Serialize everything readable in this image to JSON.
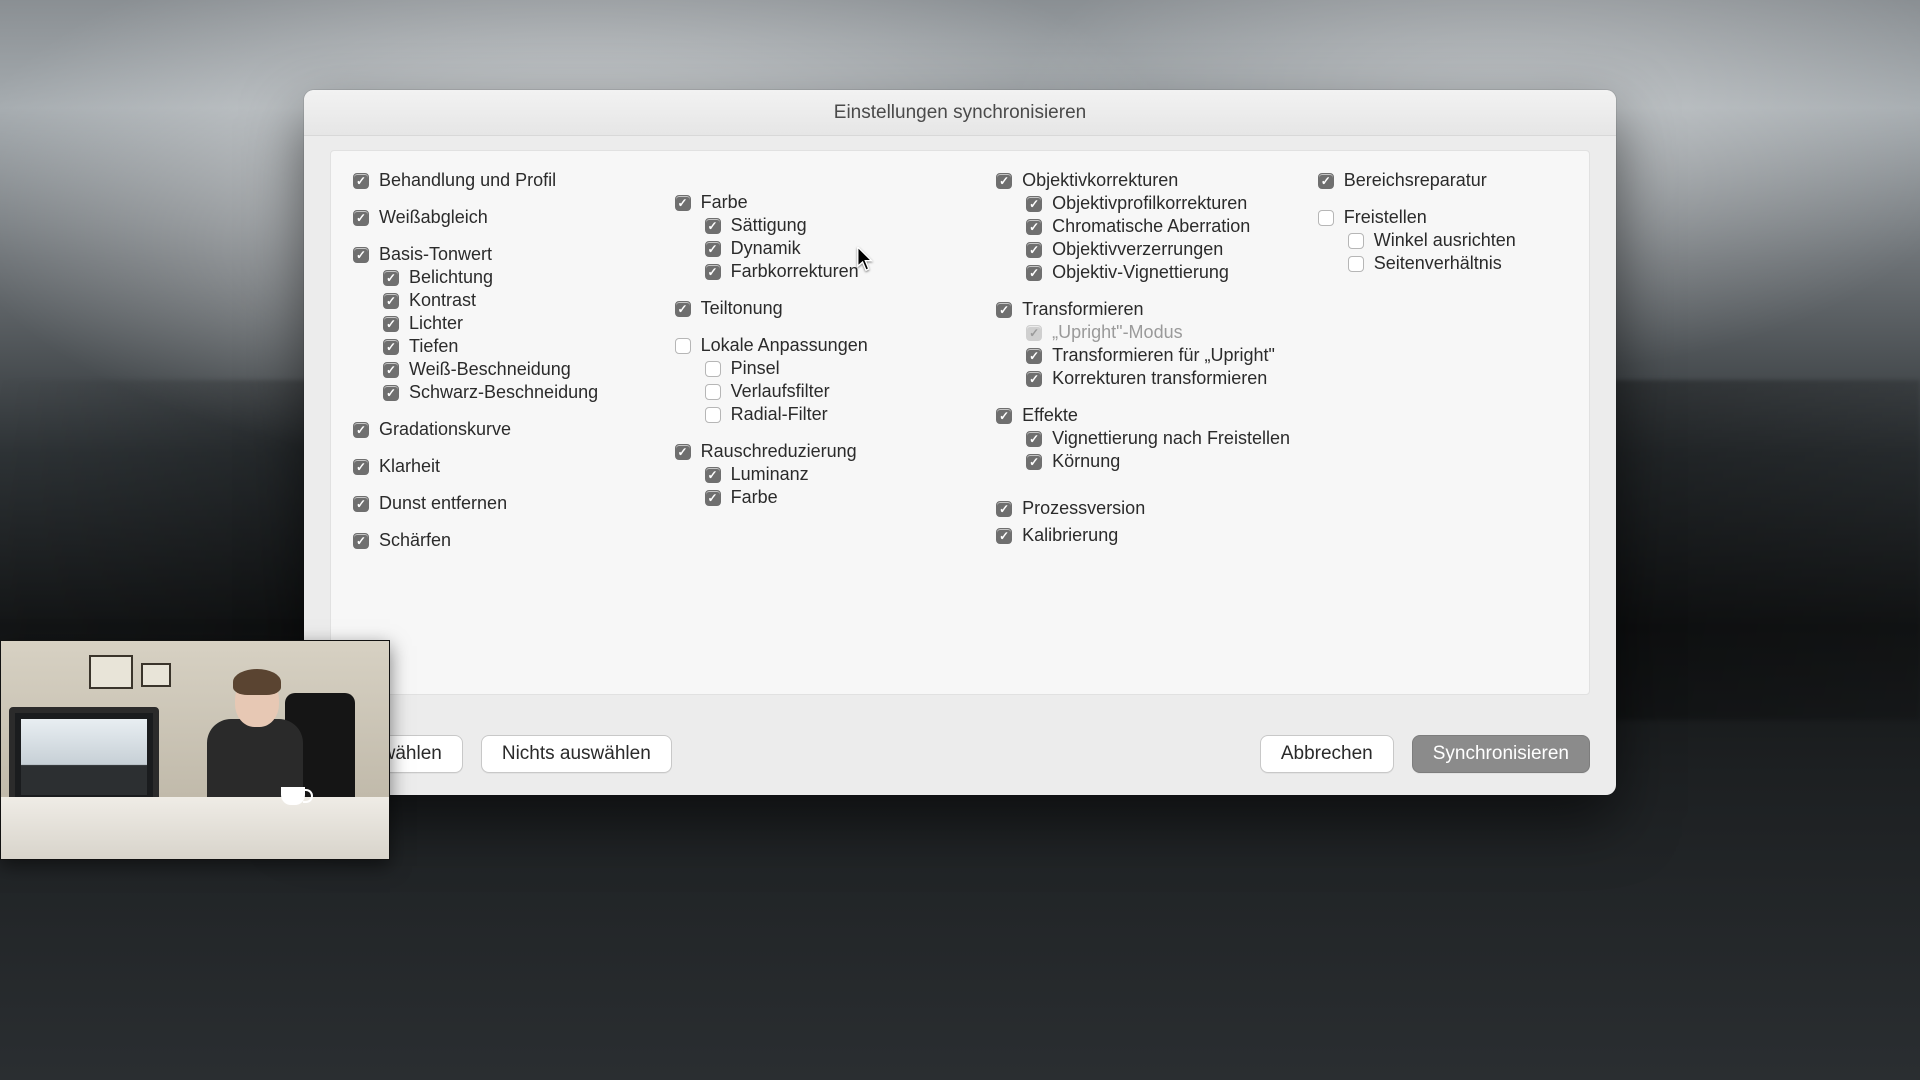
{
  "dialog": {
    "title": "Einstellungen synchronisieren",
    "buttons": {
      "select_all": "auswählen",
      "select_none": "Nichts auswählen",
      "cancel": "Abbrechen",
      "sync": "Synchronisieren"
    }
  },
  "col1": {
    "treatment_profile": "Behandlung und Profil",
    "white_balance": "Weißabgleich",
    "basic_tone": {
      "label": "Basis-Tonwert",
      "exposure": "Belichtung",
      "contrast": "Kontrast",
      "highlights": "Lichter",
      "shadows": "Tiefen",
      "white_clip": "Weiß-Beschneidung",
      "black_clip": "Schwarz-Beschneidung"
    },
    "tone_curve": "Gradationskurve",
    "clarity": "Klarheit",
    "dehaze": "Dunst entfernen",
    "sharpen": "Schärfen"
  },
  "col2": {
    "color": {
      "label": "Farbe",
      "saturation": "Sättigung",
      "vibrance": "Dynamik",
      "color_adjust": "Farbkorrekturen"
    },
    "split_toning": "Teiltonung",
    "local": {
      "label": "Lokale Anpassungen",
      "brush": "Pinsel",
      "gradient": "Verlaufsfilter",
      "radial": "Radial-Filter"
    },
    "noise": {
      "label": "Rauschreduzierung",
      "luminance": "Luminanz",
      "color": "Farbe"
    }
  },
  "col3": {
    "lens": {
      "label": "Objektivkorrekturen",
      "profile": "Objektivprofilkorrekturen",
      "chromatic": "Chromatische Aberration",
      "distortion": "Objektivverzerrungen",
      "vignette": "Objektiv-Vignettierung"
    },
    "transform": {
      "label": "Transformieren",
      "upright_mode": "„Upright\"-Modus",
      "transform_upright": "Transformieren für „Upright\"",
      "transform_corr": "Korrekturen transformieren"
    },
    "effects": {
      "label": "Effekte",
      "post_crop_vignette": "Vignettierung nach Freistellen",
      "grain": "Körnung"
    },
    "process_version": "Prozessversion",
    "calibration": "Kalibrierung"
  },
  "col4": {
    "spot_removal": "Bereichsreparatur",
    "crop": {
      "label": "Freistellen",
      "straighten": "Winkel ausrichten",
      "aspect": "Seitenverhältnis"
    }
  }
}
